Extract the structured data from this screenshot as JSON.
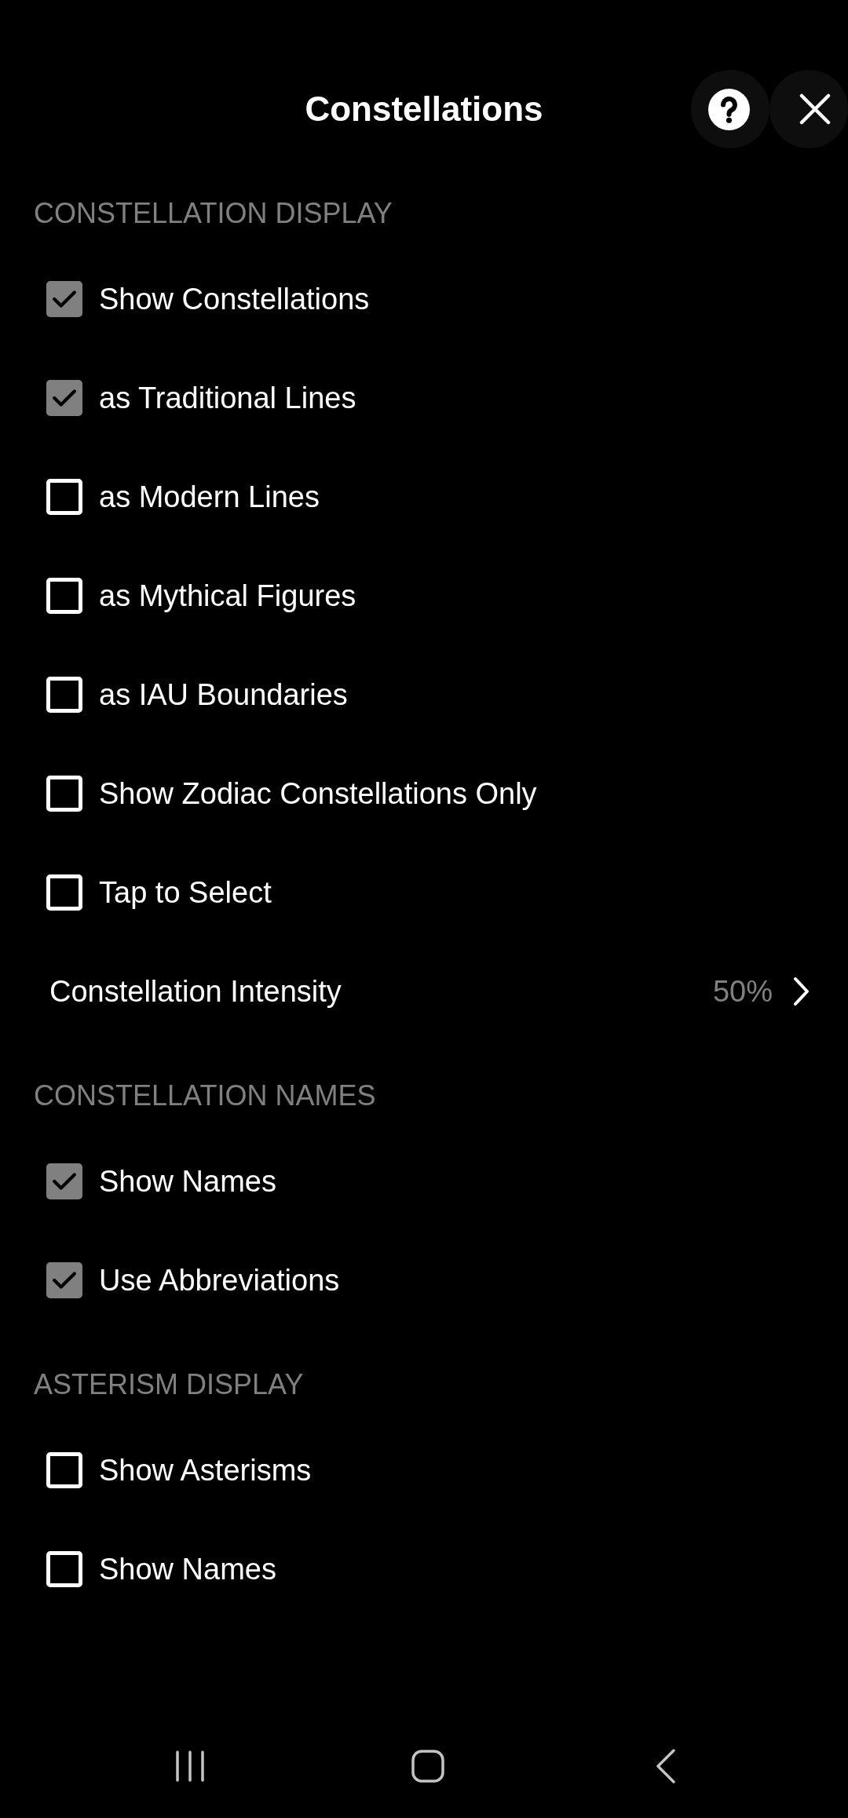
{
  "header": {
    "title": "Constellations"
  },
  "sections": [
    {
      "heading": "CONSTELLATION DISPLAY",
      "items": [
        {
          "kind": "checkbox",
          "label": "Show Constellations",
          "checked": true
        },
        {
          "kind": "checkbox",
          "label": "as Traditional Lines",
          "checked": true
        },
        {
          "kind": "checkbox",
          "label": "as Modern Lines",
          "checked": false
        },
        {
          "kind": "checkbox",
          "label": "as Mythical Figures",
          "checked": false
        },
        {
          "kind": "checkbox",
          "label": "as IAU Boundaries",
          "checked": false
        },
        {
          "kind": "checkbox",
          "label": "Show Zodiac Constellations Only",
          "checked": false
        },
        {
          "kind": "checkbox",
          "label": "Tap to Select",
          "checked": false
        },
        {
          "kind": "link",
          "label": "Constellation Intensity",
          "value": "50%"
        }
      ]
    },
    {
      "heading": "CONSTELLATION NAMES",
      "items": [
        {
          "kind": "checkbox",
          "label": "Show Names",
          "checked": true
        },
        {
          "kind": "checkbox",
          "label": "Use Abbreviations",
          "checked": true
        }
      ]
    },
    {
      "heading": "ASTERISM DISPLAY",
      "items": [
        {
          "kind": "checkbox",
          "label": "Show Asterisms",
          "checked": false
        },
        {
          "kind": "checkbox",
          "label": "Show Names",
          "checked": false
        }
      ]
    }
  ]
}
